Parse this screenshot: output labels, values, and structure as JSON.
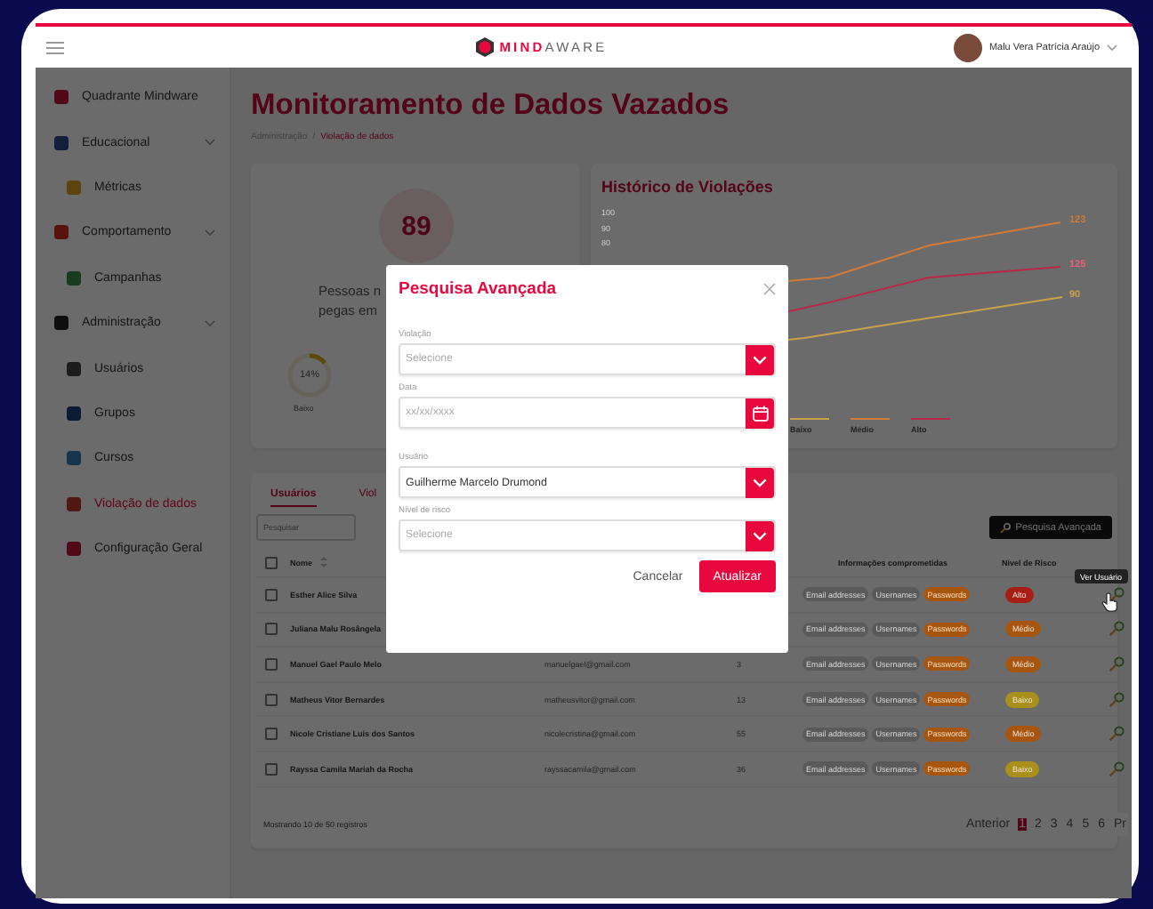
{
  "header": {
    "brand": "**MIND**AWARE",
    "user_name": "Malu Vera Patrícia Araújo"
  },
  "sidebar": {
    "items": [
      {
        "label": "Quadrante Mindware",
        "selected": false
      },
      {
        "label": "Educacional",
        "selected": false,
        "expanded": true,
        "children": [
          {
            "label": "Métricas",
            "selected": false
          }
        ]
      },
      {
        "label": "Comportamento",
        "selected": false,
        "expanded": true,
        "children": [
          {
            "label": "Campanhas",
            "selected": false
          }
        ]
      },
      {
        "label": "Administração",
        "selected": false,
        "expanded": true,
        "children": [
          {
            "label": "Usuários",
            "selected": false
          },
          {
            "label": "Grupos",
            "selected": false
          },
          {
            "label": "Cursos",
            "selected": false
          },
          {
            "label": "Violação de dados",
            "selected": true
          },
          {
            "label": "Configuração Geral",
            "selected": false
          }
        ]
      }
    ]
  },
  "page": {
    "title": "Monitoramento de Dados Vazados",
    "breadcrumb_separator": "/",
    "breadcrumb": [
      {
        "label": "Administração",
        "selected": false
      },
      {
        "label": "Violação de dados",
        "selected": true
      }
    ]
  },
  "summary": {
    "count": "89",
    "text_lines": [
      "Pessoas n",
      "pegas em"
    ],
    "gauge": {
      "value": "14%",
      "level": 0.14,
      "label": "Baixo"
    }
  },
  "chart": {
    "title": "Histórico de Violações",
    "y_labels": [
      "100",
      "90",
      "80"
    ],
    "series": [
      {
        "name": "Baixo",
        "color": "#c9a24a"
      },
      {
        "name": "Médio",
        "color": "#d27a38"
      },
      {
        "name": "Alto",
        "color": "#b8284a"
      }
    ],
    "end_labels": [
      {
        "label": "123",
        "color": "#d27a38"
      },
      {
        "label": "125",
        "color": "#f0607e"
      },
      {
        "label": "90",
        "color": "#c9a24a"
      }
    ]
  },
  "table": {
    "tabs": [
      {
        "label": "Usuários",
        "selected": true
      },
      {
        "label": "Viol",
        "selected": false
      }
    ],
    "search": {
      "placeholder": "Pesquisar"
    },
    "advanced_button": "Pesquisa Avançada",
    "header": {
      "checked": false,
      "name": "Nome",
      "info": "Informações comprometidas",
      "risk": "Nível de Risco"
    },
    "tooltip": "Ver Usuário",
    "rows": [
      {
        "checked": false,
        "name": "Esther Alice Silva",
        "tags": [
          {
            "label": "Email addresses",
            "kind": "plain"
          },
          {
            "label": "Usernames",
            "kind": "plain"
          },
          {
            "label": "Passwords",
            "kind": "alert"
          }
        ],
        "risk": {
          "label": "Alto",
          "color": "#a81e14"
        }
      },
      {
        "checked": false,
        "name": "Juliana Malu Rosângela",
        "tags": [
          {
            "label": "Email addresses",
            "kind": "plain"
          },
          {
            "label": "Usernames",
            "kind": "plain"
          },
          {
            "label": "Passwords",
            "kind": "alert"
          }
        ],
        "risk": {
          "label": "Médio",
          "color": "#a8560f"
        }
      },
      {
        "checked": false,
        "name": "Manuel Gael Paulo Melo",
        "email": "manuelgael@gmail.com",
        "count": "3",
        "tags": [
          {
            "label": "Email addresses",
            "kind": "plain"
          },
          {
            "label": "Usernames",
            "kind": "plain"
          },
          {
            "label": "Passwords",
            "kind": "alert"
          }
        ],
        "risk": {
          "label": "Médio",
          "color": "#a8560f"
        }
      },
      {
        "checked": false,
        "name": "Matheus Vitor Bernardes",
        "email": "matheusvitor@gmail.com",
        "count": "13",
        "tags": [
          {
            "label": "Email addresses",
            "kind": "plain"
          },
          {
            "label": "Usernames",
            "kind": "plain"
          },
          {
            "label": "Passwords",
            "kind": "alert"
          }
        ],
        "risk": {
          "label": "Baixo",
          "color": "#a8901a"
        }
      },
      {
        "checked": false,
        "name": "Nicole Cristiane Luis dos Santos",
        "email": "nicolecristina@gmail.com",
        "count": "55",
        "tags": [
          {
            "label": "Email addresses",
            "kind": "plain"
          },
          {
            "label": "Usernames",
            "kind": "plain"
          },
          {
            "label": "Passwords",
            "kind": "alert"
          }
        ],
        "risk": {
          "label": "Médio",
          "color": "#a8560f"
        }
      },
      {
        "checked": false,
        "name": "Rayssa Camila Mariah da Rocha",
        "email": "rayssacamila@gmail.com",
        "count": "36",
        "tags": [
          {
            "label": "Email addresses",
            "kind": "plain"
          },
          {
            "label": "Usernames",
            "kind": "plain"
          },
          {
            "label": "Passwords",
            "kind": "alert"
          }
        ],
        "risk": {
          "label": "Baixo",
          "color": "#a8901a"
        }
      }
    ],
    "footer": "Mostrando 10 de 50 registros",
    "pagination": [
      {
        "label": "Anterior",
        "selected": false
      },
      {
        "label": "1",
        "selected": true
      },
      {
        "label": "2",
        "selected": false
      },
      {
        "label": "3",
        "selected": false
      },
      {
        "label": "4",
        "selected": false
      },
      {
        "label": "5",
        "selected": false
      },
      {
        "label": "6",
        "selected": false
      },
      {
        "label": "Pr",
        "selected": false
      }
    ]
  },
  "modal": {
    "title": "Pesquisa Avançada",
    "fields": [
      {
        "label": "Violação",
        "kind": "select",
        "placeholder": "Selecione"
      },
      {
        "label": "Data",
        "kind": "date",
        "placeholder": "xx/xx/xxxx"
      },
      {
        "label": "Usuário",
        "kind": "select",
        "value": "Guilherme Marcelo Drumond"
      },
      {
        "label": "Nível de risco",
        "kind": "select",
        "placeholder": "Selecione"
      }
    ],
    "buttons": [
      {
        "label": "Cancelar",
        "kind": "secondary"
      },
      {
        "label": "Atualizar",
        "kind": "primary"
      }
    ]
  }
}
